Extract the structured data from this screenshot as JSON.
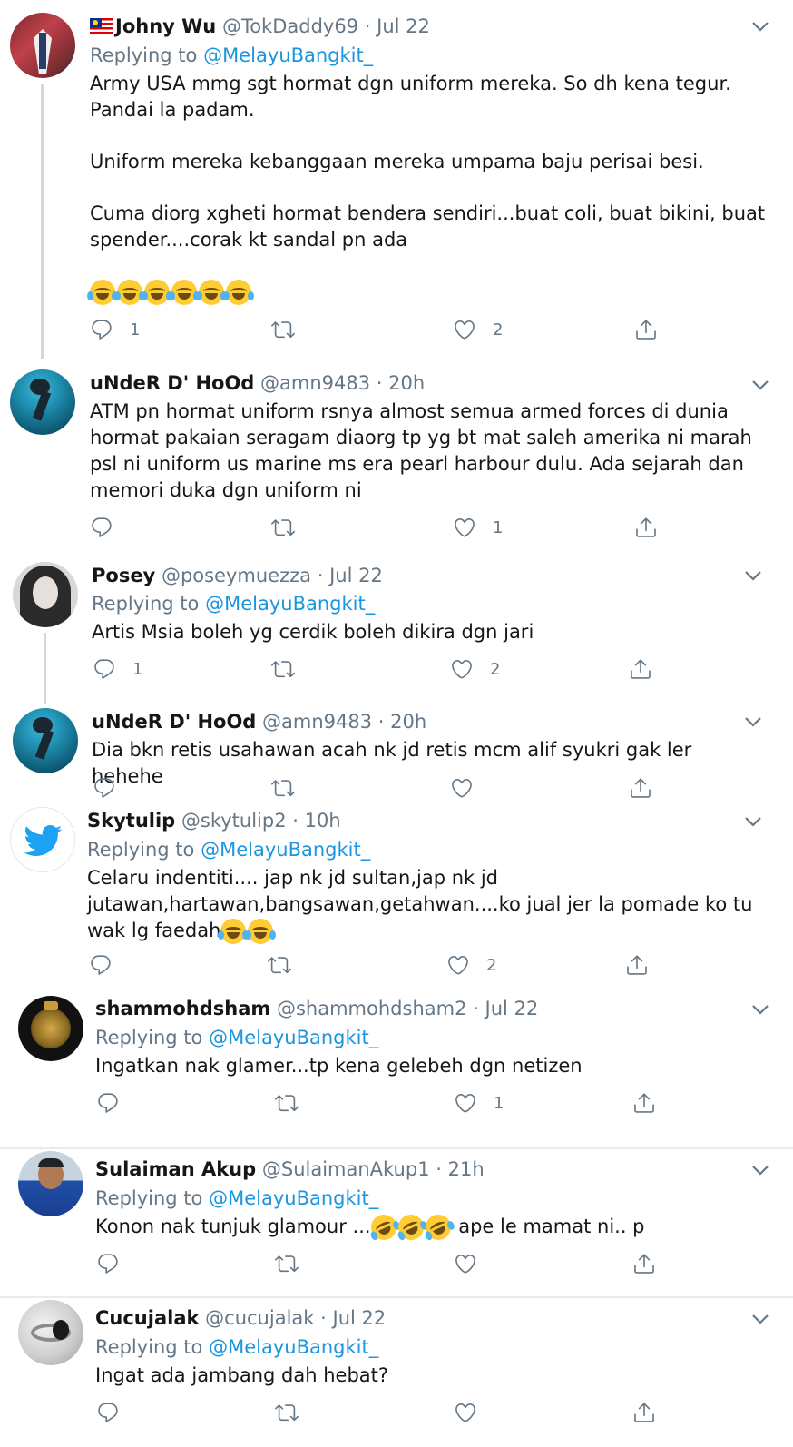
{
  "tweets": [
    {
      "name": "Johny Wu",
      "handle": "@TokDaddy69",
      "sep": "·",
      "time": "Jul 22",
      "reply_prefix": "Replying to",
      "reply_to": "@MelayuBangkit_",
      "paragraphs": [
        "Army USA mmg sgt hormat dgn uniform mereka. So dh kena tegur. Pandai la padam.",
        "Uniform mereka kebanggaan mereka umpama baju perisai besi.",
        "Cuma diorg xgheti hormat bendera sendiri...buat coli, buat bikini, buat spender....corak kt sandal pn ada"
      ],
      "replies": "1",
      "retweets": "",
      "likes": "2"
    },
    {
      "name": "uNdeR D' HoOd",
      "handle": "@amn9483",
      "sep": "·",
      "time": "20h",
      "text": "ATM pn hormat uniform rsnya almost semua armed forces di dunia hormat pakaian seragam diaorg tp yg bt mat saleh amerika ni marah psl ni uniform us marine ms era pearl harbour dulu. Ada sejarah dan memori duka dgn uniform ni",
      "replies": "",
      "retweets": "",
      "likes": "1"
    },
    {
      "name": "Posey",
      "handle": "@poseymuezza",
      "sep": "·",
      "time": "Jul 22",
      "reply_prefix": "Replying to",
      "reply_to": "@MelayuBangkit_",
      "text": "Artis Msia boleh yg cerdik boleh dikira dgn jari",
      "replies": "1",
      "retweets": "",
      "likes": "2"
    },
    {
      "name": "uNdeR D' HoOd",
      "handle": "@amn9483",
      "sep": "·",
      "time": "20h",
      "text": "Dia bkn retis usahawan acah nk jd retis mcm alif syukri gak ler hehehe",
      "replies": "",
      "retweets": "",
      "likes": ""
    },
    {
      "name": "Skytulip",
      "handle": "@skytulip2",
      "sep": "·",
      "time": "10h",
      "reply_prefix": "Replying to",
      "reply_to": "@MelayuBangkit_",
      "text": "Celaru indentiti.... jap nk jd sultan,jap nk jd jutawan,hartawan,bangsawan,getahwan....ko jual jer la pomade ko tu wak lg faedah",
      "replies": "",
      "retweets": "",
      "likes": "2"
    },
    {
      "name": "shammohdsham",
      "handle": "@shammohdsham2",
      "sep": "·",
      "time": "Jul 22",
      "reply_prefix": "Replying to",
      "reply_to": "@MelayuBangkit_",
      "text": "Ingatkan nak glamer...tp kena gelebeh dgn netizen",
      "replies": "",
      "retweets": "",
      "likes": "1"
    },
    {
      "name": "Sulaiman Akup",
      "handle": "@SulaimanAkup1",
      "sep": "·",
      "time": "21h",
      "reply_prefix": "Replying to",
      "reply_to": "@MelayuBangkit_",
      "text_before": "Konon nak tunjuk glamour ...",
      "text_after": " ape le mamat ni.. p",
      "replies": "",
      "retweets": "",
      "likes": ""
    },
    {
      "name": "Cucujalak",
      "handle": "@cucujalak",
      "sep": "·",
      "time": "Jul 22",
      "reply_prefix": "Replying to",
      "reply_to": "@MelayuBangkit_",
      "text": "Ingat ada jambang dah hebat?",
      "replies": "",
      "retweets": "",
      "likes": ""
    }
  ],
  "icons": {
    "reply": "reply-icon",
    "retweet": "retweet-icon",
    "like": "heart-icon",
    "share": "share-icon",
    "more": "chevron-down-icon"
  },
  "colors": {
    "link": "#1b95e0",
    "muted": "#657786",
    "text": "#14171a",
    "divider": "#e6ecf0"
  }
}
